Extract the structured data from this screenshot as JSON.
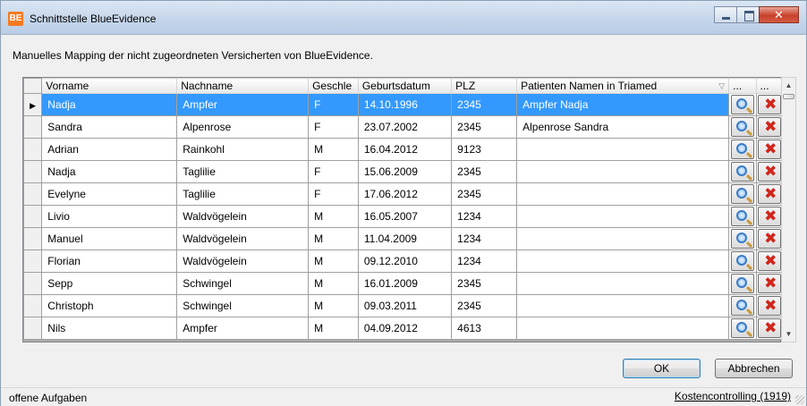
{
  "window": {
    "app_icon": "BE",
    "title": "Schnittstelle BlueEvidence"
  },
  "instruction": "Manuelles Mapping der nicht zugeordneten Versicherten von BlueEvidence.",
  "table": {
    "columns": [
      "Vorname",
      "Nachname",
      "Geschle",
      "Geburtsdatum",
      "PLZ",
      "Patienten Namen in Triamed",
      "...",
      "..."
    ],
    "rows": [
      {
        "vorname": "Nadja",
        "nachname": "Ampfer",
        "geschlecht": "F",
        "geburtsdatum": "14.10.1996",
        "plz": "2345",
        "patient": "Ampfer Nadja",
        "selected": true
      },
      {
        "vorname": "Sandra",
        "nachname": "Alpenrose",
        "geschlecht": "F",
        "geburtsdatum": "23.07.2002",
        "plz": "2345",
        "patient": "Alpenrose Sandra"
      },
      {
        "vorname": "Adrian",
        "nachname": "Rainkohl",
        "geschlecht": "M",
        "geburtsdatum": "16.04.2012",
        "plz": "9123",
        "patient": ""
      },
      {
        "vorname": "Nadja",
        "nachname": "Taglilie",
        "geschlecht": "F",
        "geburtsdatum": "15.06.2009",
        "plz": "2345",
        "patient": ""
      },
      {
        "vorname": "Evelyne",
        "nachname": "Taglilie",
        "geschlecht": "F",
        "geburtsdatum": "17.06.2012",
        "plz": "2345",
        "patient": ""
      },
      {
        "vorname": "Livio",
        "nachname": "Waldvögelein",
        "geschlecht": "M",
        "geburtsdatum": "16.05.2007",
        "plz": "1234",
        "patient": ""
      },
      {
        "vorname": "Manuel",
        "nachname": "Waldvögelein",
        "geschlecht": "M",
        "geburtsdatum": "11.04.2009",
        "plz": "1234",
        "patient": ""
      },
      {
        "vorname": "Florian",
        "nachname": "Waldvögelein",
        "geschlecht": "M",
        "geburtsdatum": "09.12.2010",
        "plz": "1234",
        "patient": ""
      },
      {
        "vorname": "Sepp",
        "nachname": "Schwingel",
        "geschlecht": "M",
        "geburtsdatum": "16.01.2009",
        "plz": "2345",
        "patient": ""
      },
      {
        "vorname": "Christoph",
        "nachname": "Schwingel",
        "geschlecht": "M",
        "geburtsdatum": "09.03.2011",
        "plz": "2345",
        "patient": ""
      },
      {
        "vorname": "Nils",
        "nachname": "Ampfer",
        "geschlecht": "M",
        "geburtsdatum": "04.09.2012",
        "plz": "4613",
        "patient": ""
      }
    ],
    "row_icons": [
      "search-icon",
      "delete-icon"
    ]
  },
  "buttons": {
    "ok": "OK",
    "cancel": "Abbrechen"
  },
  "statusbar": {
    "left": "offene Aufgaben",
    "right": "Kostencontrolling (1919)"
  },
  "colors": {
    "selection": "#3399ff",
    "delete_icon": "#d0261c",
    "app_icon": "#f47a21"
  }
}
